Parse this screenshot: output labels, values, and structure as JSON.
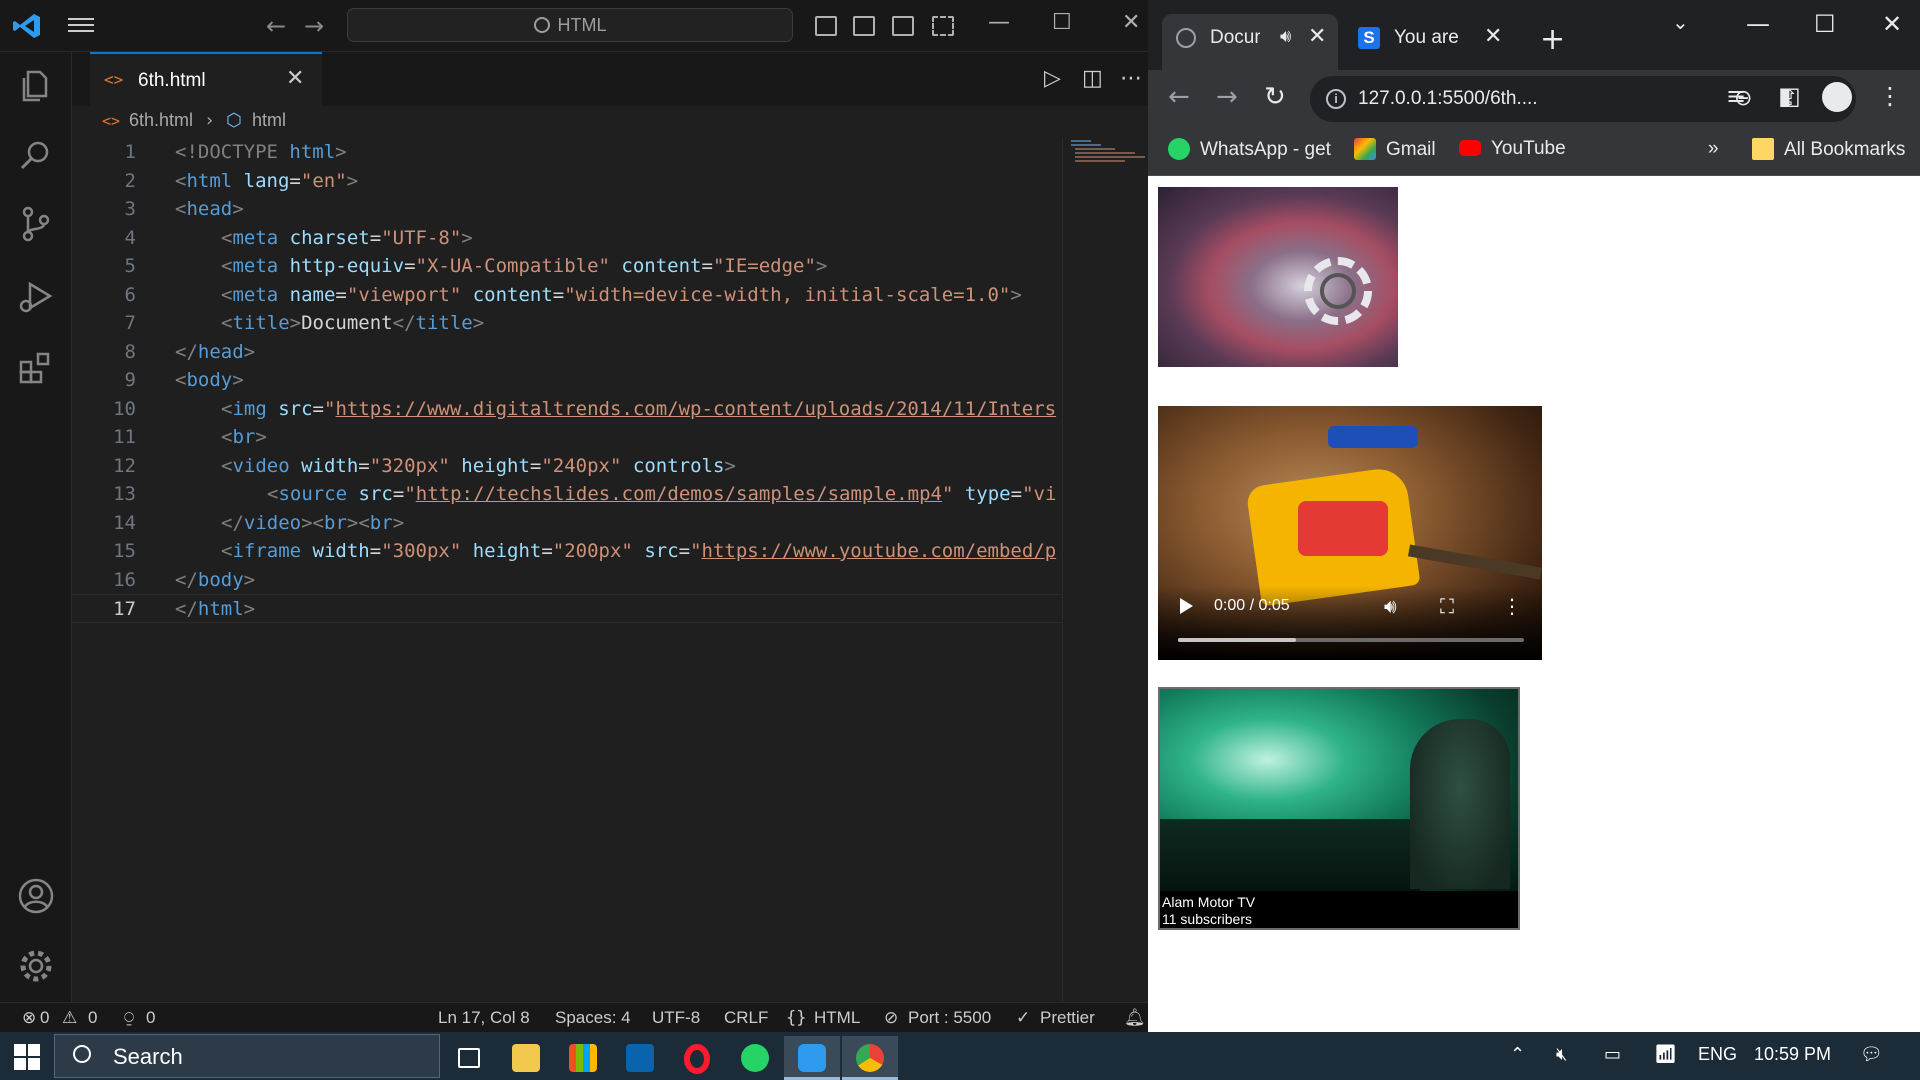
{
  "vscode": {
    "search_placeholder": "HTML",
    "tab": {
      "label": "6th.html"
    },
    "breadcrumb": {
      "file": "6th.html",
      "symbol": "html"
    },
    "line_numbers": [
      "1",
      "2",
      "3",
      "4",
      "5",
      "6",
      "7",
      "8",
      "9",
      "10",
      "11",
      "12",
      "13",
      "14",
      "15",
      "16",
      "17"
    ],
    "current_line": 17,
    "code": {
      "l1": [
        "<!DOCTYPE",
        " html",
        ">"
      ],
      "l2": [
        "<",
        "html",
        " lang",
        "=",
        "\"en\"",
        ">"
      ],
      "l3": [
        "<",
        "head",
        ">"
      ],
      "l4": [
        "<",
        "meta",
        " charset",
        "=",
        "\"UTF-8\"",
        ">"
      ],
      "l5": [
        "<",
        "meta",
        " http-equiv",
        "=",
        "\"X-UA-Compatible\"",
        " content",
        "=",
        "\"IE=edge\"",
        ">"
      ],
      "l6": [
        "<",
        "meta",
        " name",
        "=",
        "\"viewport\"",
        " content",
        "=",
        "\"width=device-width, initial-scale=1.0\"",
        ">"
      ],
      "l7": [
        "<",
        "title",
        ">",
        "Document",
        "</",
        "title",
        ">"
      ],
      "l8": [
        "</",
        "head",
        ">"
      ],
      "l9": [
        "<",
        "body",
        ">"
      ],
      "l10": [
        "<",
        "img",
        " src",
        "=",
        "\"",
        "https://www.digitaltrends.com/wp-content/uploads/2014/11/Inters"
      ],
      "l11": [
        "<",
        "br",
        ">"
      ],
      "l12": [
        "<",
        "video",
        " width",
        "=",
        "\"320px\"",
        " height",
        "=",
        "\"240px\"",
        " controls",
        ">"
      ],
      "l13": [
        "<",
        "source",
        " src",
        "=",
        "\"",
        "http://techslides.com/demos/samples/sample.mp4",
        "\"",
        " type",
        "=",
        "\"vi"
      ],
      "l14": [
        "</",
        "video",
        ">",
        "<",
        "br",
        ">",
        "<",
        "br",
        ">"
      ],
      "l15": [
        "<",
        "iframe",
        " width",
        "=",
        "\"300px\"",
        " height",
        "=",
        "\"200px\"",
        " src",
        "=",
        "\"",
        "https://www.youtube.com/embed/p"
      ],
      "l16": [
        "</",
        "body",
        ">"
      ],
      "l17": [
        "</",
        "html",
        ">"
      ]
    },
    "status": {
      "errors": "0",
      "warnings": "0",
      "ports": "0",
      "position": "Ln 17, Col 8",
      "spaces": "Spaces: 4",
      "encoding": "UTF-8",
      "eol": "CRLF",
      "language": "HTML",
      "port": "Port : 5500",
      "formatter": "Prettier"
    }
  },
  "chrome": {
    "tabs": [
      {
        "title": "Document"
      },
      {
        "title": "You are signed in"
      }
    ],
    "url": "127.0.0.1:5500/6th....",
    "bookmarks": [
      {
        "label": "WhatsApp - get",
        "icon": "whatsapp-icon"
      },
      {
        "label": "Gmail",
        "icon": "gmail-icon"
      },
      {
        "label": "YouTube",
        "icon": "youtube-icon"
      }
    ],
    "bookmarks_overflow": "»",
    "all_bookmarks": "All Bookmarks",
    "video": {
      "time": "0:00 / 0:05",
      "buffered_fraction": 0.34
    },
    "iframe": {
      "channel": "Alam Motor TV",
      "subscribers": "11 subscribers"
    }
  },
  "taskbar": {
    "search_label": "Search",
    "language": "ENG",
    "time": "10:59 PM"
  },
  "colors": {
    "vscode_accent": "#0078d4",
    "tag": "#569cd6",
    "attribute": "#9cdcfe",
    "string": "#ce9178",
    "html_icon": "#e37933"
  }
}
